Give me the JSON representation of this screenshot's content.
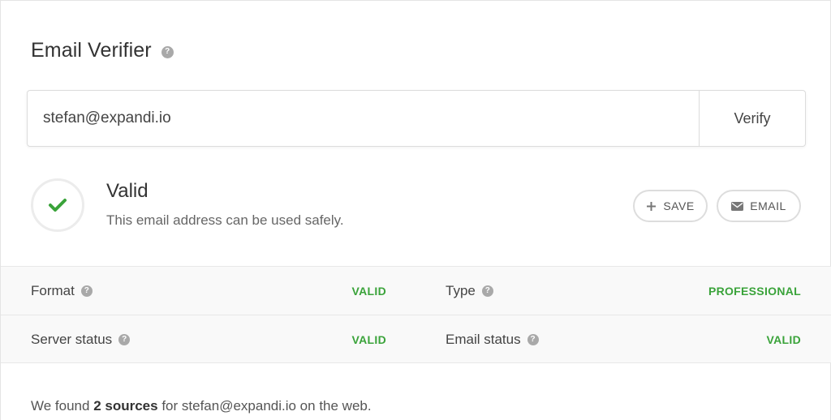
{
  "header": {
    "title": "Email Verifier"
  },
  "search": {
    "value": "stefan@expandi.io",
    "verify_label": "Verify"
  },
  "result": {
    "status_title": "Valid",
    "status_description": "This email address can be used safely.",
    "icon": "check-icon",
    "status_color": "#3aa33a"
  },
  "actions": {
    "save_label": "SAVE",
    "email_label": "EMAIL"
  },
  "stats": [
    {
      "label": "Format",
      "value": "VALID",
      "label2": "Type",
      "value2": "PROFESSIONAL"
    },
    {
      "label": "Server status",
      "value": "VALID",
      "label2": "Email status",
      "value2": "VALID"
    }
  ],
  "footer": {
    "prefix": "We found",
    "sources": "2 sources",
    "suffix": "for stefan@expandi.io on the web."
  }
}
